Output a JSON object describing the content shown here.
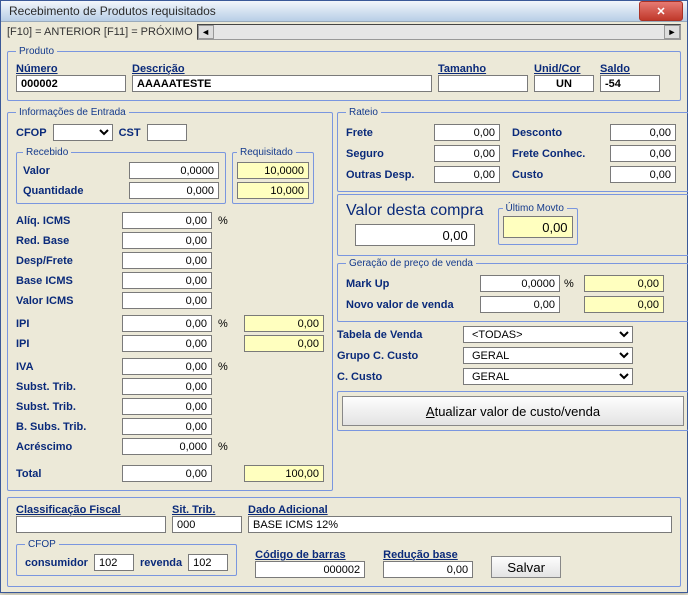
{
  "window": {
    "title": "Recebimento de Produtos requisitados"
  },
  "nav": {
    "text": "[F10] = ANTERIOR  [F11] = PRÓXIMO"
  },
  "produto": {
    "legend": "Produto",
    "numero_lbl": "Número",
    "numero": "000002",
    "descricao_lbl": "Descrição",
    "descricao": "AAAAATESTE",
    "tamanho_lbl": "Tamanho",
    "tamanho": "",
    "unidcor_lbl": "Unid/Cor",
    "unidcor": "UN",
    "saldo_lbl": "Saldo",
    "saldo": "-54"
  },
  "info": {
    "legend": "Informações de Entrada",
    "cfop_lbl": "CFOP",
    "cfop": "",
    "cst_lbl": "CST",
    "cst": "",
    "recebido_legend": "Recebido",
    "valor_lbl": "Valor",
    "valor": "0,0000",
    "quantidade_lbl": "Quantidade",
    "quantidade": "0,000",
    "aliq_lbl": "Alíq. ICMS",
    "aliq": "0,00",
    "redbase_lbl": "Red. Base",
    "redbase": "0,00",
    "despfrete_lbl": "Desp/Frete",
    "despfrete": "0,00",
    "baseicms_lbl": "Base ICMS",
    "baseicms": "0,00",
    "valoricms_lbl": "Valor ICMS",
    "valoricms": "0,00",
    "ipi_pct_lbl": "IPI",
    "ipi_pct": "0,00",
    "ipi_val_lbl": "IPI",
    "ipi_val": "0,00",
    "iva_lbl": "IVA",
    "iva": "0,00",
    "subst1_lbl": "Subst. Trib.",
    "subst1": "0,00",
    "subst2_lbl": "Subst. Trib.",
    "subst2": "0,00",
    "bsubs_lbl": "B. Subs. Trib.",
    "bsubs": "0,00",
    "acresc_lbl": "Acréscimo",
    "acresc": "0,000",
    "total_lbl": "Total",
    "total": "0,00",
    "requisitado_legend": "Requisitado",
    "req_valor": "10,0000",
    "req_qtd": "10,000",
    "ipi_y1": "0,00",
    "ipi_y2": "0,00",
    "total_y": "100,00"
  },
  "rateio": {
    "legend": "Rateio",
    "frete_lbl": "Frete",
    "frete": "0,00",
    "desconto_lbl": "Desconto",
    "desconto": "0,00",
    "seguro_lbl": "Seguro",
    "seguro": "0,00",
    "freteconhec_lbl": "Frete Conhec.",
    "freteconhec": "0,00",
    "outras_lbl": "Outras Desp.",
    "outras": "0,00",
    "custo_lbl": "Custo",
    "custo": "0,00"
  },
  "compra": {
    "title": "Valor desta compra",
    "valor": "0,00",
    "ultimo_legend": "Último Movto",
    "ultimo": "0,00"
  },
  "geracao": {
    "legend": "Geração de preço de venda",
    "markup_lbl": "Mark Up",
    "markup": "0,0000",
    "markup_y": "0,00",
    "novo_lbl": "Novo valor de venda",
    "novo": "0,00",
    "novo_y": "0,00"
  },
  "venda": {
    "tabela_lbl": "Tabela de Venda",
    "tabela": "<TODAS>",
    "grupo_lbl": "Grupo C. Custo",
    "grupo": "GERAL",
    "ccusto_lbl": "C. Custo",
    "ccusto": "GERAL"
  },
  "atualizar_btn": "Atualizar valor de custo/venda",
  "bottom": {
    "classif_lbl": "Classificação Fiscal",
    "classif": "",
    "sittrib_lbl": "Sit. Trib.",
    "sittrib": "000",
    "dado_lbl": "Dado Adicional",
    "dado": "BASE ICMS 12%",
    "cfop_legend": "CFOP",
    "consumidor_lbl": "consumidor",
    "consumidor": "102",
    "revenda_lbl": "revenda",
    "revenda": "102",
    "codbarras_lbl": "Código de barras",
    "codbarras": "000002",
    "reducao_lbl": "Redução base",
    "reducao": "0,00",
    "salvar": "Salvar"
  }
}
